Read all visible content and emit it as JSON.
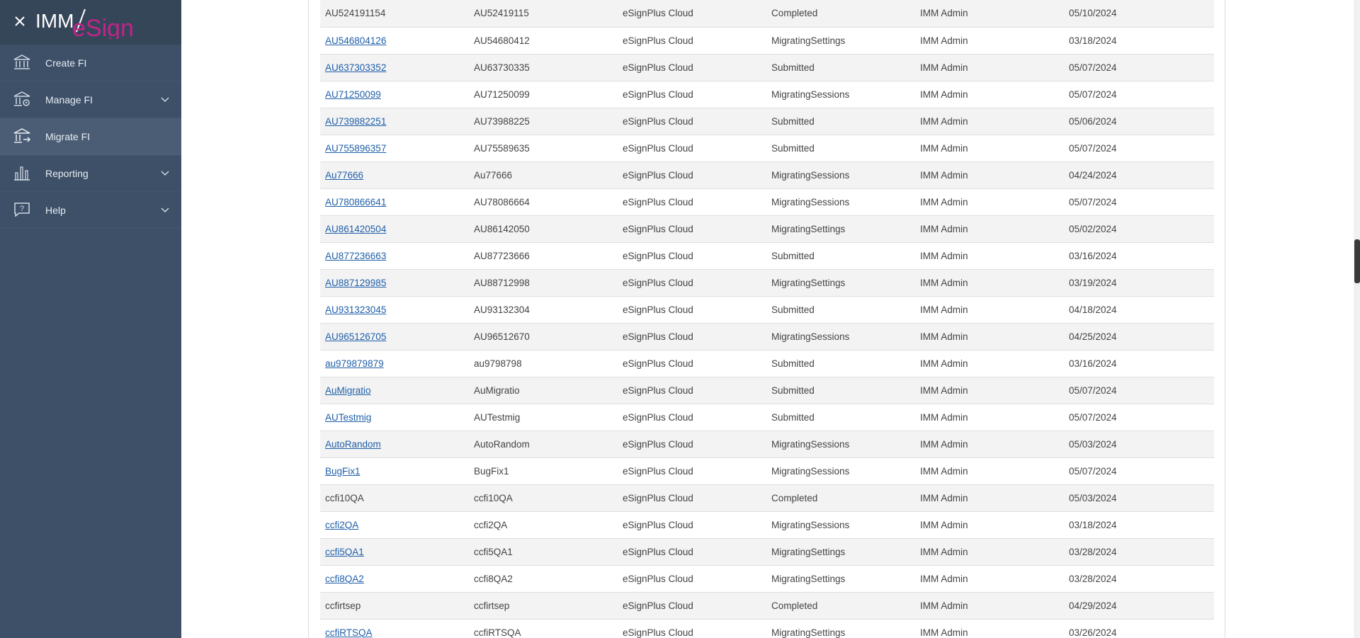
{
  "app": {
    "logo_text_imm": "IMM",
    "logo_text_esign": "eSign"
  },
  "sidebar": {
    "items": [
      {
        "label": "Create FI",
        "icon": "bank-icon",
        "has_chevron": false,
        "active": false
      },
      {
        "label": "Manage FI",
        "icon": "bank-settings-icon",
        "has_chevron": true,
        "active": false
      },
      {
        "label": "Migrate FI",
        "icon": "bank-migrate-icon",
        "has_chevron": false,
        "active": true
      },
      {
        "label": "Reporting",
        "icon": "bar-chart-icon",
        "has_chevron": true,
        "active": false
      },
      {
        "label": "Help",
        "icon": "help-icon",
        "has_chevron": true,
        "active": false
      }
    ]
  },
  "table": {
    "rows": [
      {
        "fi": "AU524191154",
        "linked": false,
        "code": "AU52419115",
        "platform": "eSignPlus Cloud",
        "status": "Completed",
        "user": "IMM Admin",
        "date": "05/10/2024"
      },
      {
        "fi": "AU546804126",
        "linked": true,
        "code": "AU54680412",
        "platform": "eSignPlus Cloud",
        "status": "MigratingSettings",
        "user": "IMM Admin",
        "date": "03/18/2024"
      },
      {
        "fi": "AU637303352",
        "linked": true,
        "code": "AU63730335",
        "platform": "eSignPlus Cloud",
        "status": "Submitted",
        "user": "IMM Admin",
        "date": "05/07/2024"
      },
      {
        "fi": "AU71250099",
        "linked": true,
        "code": "AU71250099",
        "platform": "eSignPlus Cloud",
        "status": "MigratingSessions",
        "user": "IMM Admin",
        "date": "05/07/2024"
      },
      {
        "fi": "AU739882251",
        "linked": true,
        "code": "AU73988225",
        "platform": "eSignPlus Cloud",
        "status": "Submitted",
        "user": "IMM Admin",
        "date": "05/06/2024"
      },
      {
        "fi": "AU755896357",
        "linked": true,
        "code": "AU75589635",
        "platform": "eSignPlus Cloud",
        "status": "Submitted",
        "user": "IMM Admin",
        "date": "05/07/2024"
      },
      {
        "fi": "Au77666",
        "linked": true,
        "code": "Au77666",
        "platform": "eSignPlus Cloud",
        "status": "MigratingSessions",
        "user": "IMM Admin",
        "date": "04/24/2024"
      },
      {
        "fi": "AU780866641",
        "linked": true,
        "code": "AU78086664",
        "platform": "eSignPlus Cloud",
        "status": "MigratingSessions",
        "user": "IMM Admin",
        "date": "05/07/2024"
      },
      {
        "fi": "AU861420504",
        "linked": true,
        "code": "AU86142050",
        "platform": "eSignPlus Cloud",
        "status": "MigratingSettings",
        "user": "IMM Admin",
        "date": "05/02/2024"
      },
      {
        "fi": "AU877236663",
        "linked": true,
        "code": "AU87723666",
        "platform": "eSignPlus Cloud",
        "status": "Submitted",
        "user": "IMM Admin",
        "date": "03/16/2024"
      },
      {
        "fi": "AU887129985",
        "linked": true,
        "code": "AU88712998",
        "platform": "eSignPlus Cloud",
        "status": "MigratingSettings",
        "user": "IMM Admin",
        "date": "03/19/2024"
      },
      {
        "fi": "AU931323045",
        "linked": true,
        "code": "AU93132304",
        "platform": "eSignPlus Cloud",
        "status": "Submitted",
        "user": "IMM Admin",
        "date": "04/18/2024"
      },
      {
        "fi": "AU965126705",
        "linked": true,
        "code": "AU96512670",
        "platform": "eSignPlus Cloud",
        "status": "MigratingSessions",
        "user": "IMM Admin",
        "date": "04/25/2024"
      },
      {
        "fi": "au979879879",
        "linked": true,
        "code": "au9798798",
        "platform": "eSignPlus Cloud",
        "status": "Submitted",
        "user": "IMM Admin",
        "date": "03/16/2024"
      },
      {
        "fi": "AuMigratio",
        "linked": true,
        "code": "AuMigratio",
        "platform": "eSignPlus Cloud",
        "status": "Submitted",
        "user": "IMM Admin",
        "date": "05/07/2024"
      },
      {
        "fi": "AUTestmig",
        "linked": true,
        "code": "AUTestmig",
        "platform": "eSignPlus Cloud",
        "status": "Submitted",
        "user": "IMM Admin",
        "date": "05/07/2024"
      },
      {
        "fi": "AutoRandom",
        "linked": true,
        "code": "AutoRandom",
        "platform": "eSignPlus Cloud",
        "status": "MigratingSessions",
        "user": "IMM Admin",
        "date": "05/03/2024"
      },
      {
        "fi": "BugFix1",
        "linked": true,
        "code": "BugFix1",
        "platform": "eSignPlus Cloud",
        "status": "MigratingSessions",
        "user": "IMM Admin",
        "date": "05/07/2024"
      },
      {
        "fi": "ccfi10QA",
        "linked": false,
        "code": "ccfi10QA",
        "platform": "eSignPlus Cloud",
        "status": "Completed",
        "user": "IMM Admin",
        "date": "05/03/2024"
      },
      {
        "fi": "ccfi2QA",
        "linked": true,
        "code": "ccfi2QA",
        "platform": "eSignPlus Cloud",
        "status": "MigratingSessions",
        "user": "IMM Admin",
        "date": "03/18/2024"
      },
      {
        "fi": "ccfi5QA1",
        "linked": true,
        "code": "ccfi5QA1",
        "platform": "eSignPlus Cloud",
        "status": "MigratingSettings",
        "user": "IMM Admin",
        "date": "03/28/2024"
      },
      {
        "fi": "ccfi8QA2",
        "linked": true,
        "code": "ccfi8QA2",
        "platform": "eSignPlus Cloud",
        "status": "MigratingSettings",
        "user": "IMM Admin",
        "date": "03/28/2024"
      },
      {
        "fi": "ccfirtsep",
        "linked": false,
        "code": "ccfirtsep",
        "platform": "eSignPlus Cloud",
        "status": "Completed",
        "user": "IMM Admin",
        "date": "04/29/2024"
      },
      {
        "fi": "ccfiRTSQA",
        "linked": true,
        "code": "ccfiRTSQA",
        "platform": "eSignPlus Cloud",
        "status": "MigratingSettings",
        "user": "IMM Admin",
        "date": "03/26/2024"
      }
    ]
  },
  "colors": {
    "sidebar_bg": "#3d5068",
    "sidebar_header_bg": "#354659",
    "active_item_bg": "#4a5d74",
    "link": "#1f5fa8",
    "logo_esign": "#c2238a"
  }
}
